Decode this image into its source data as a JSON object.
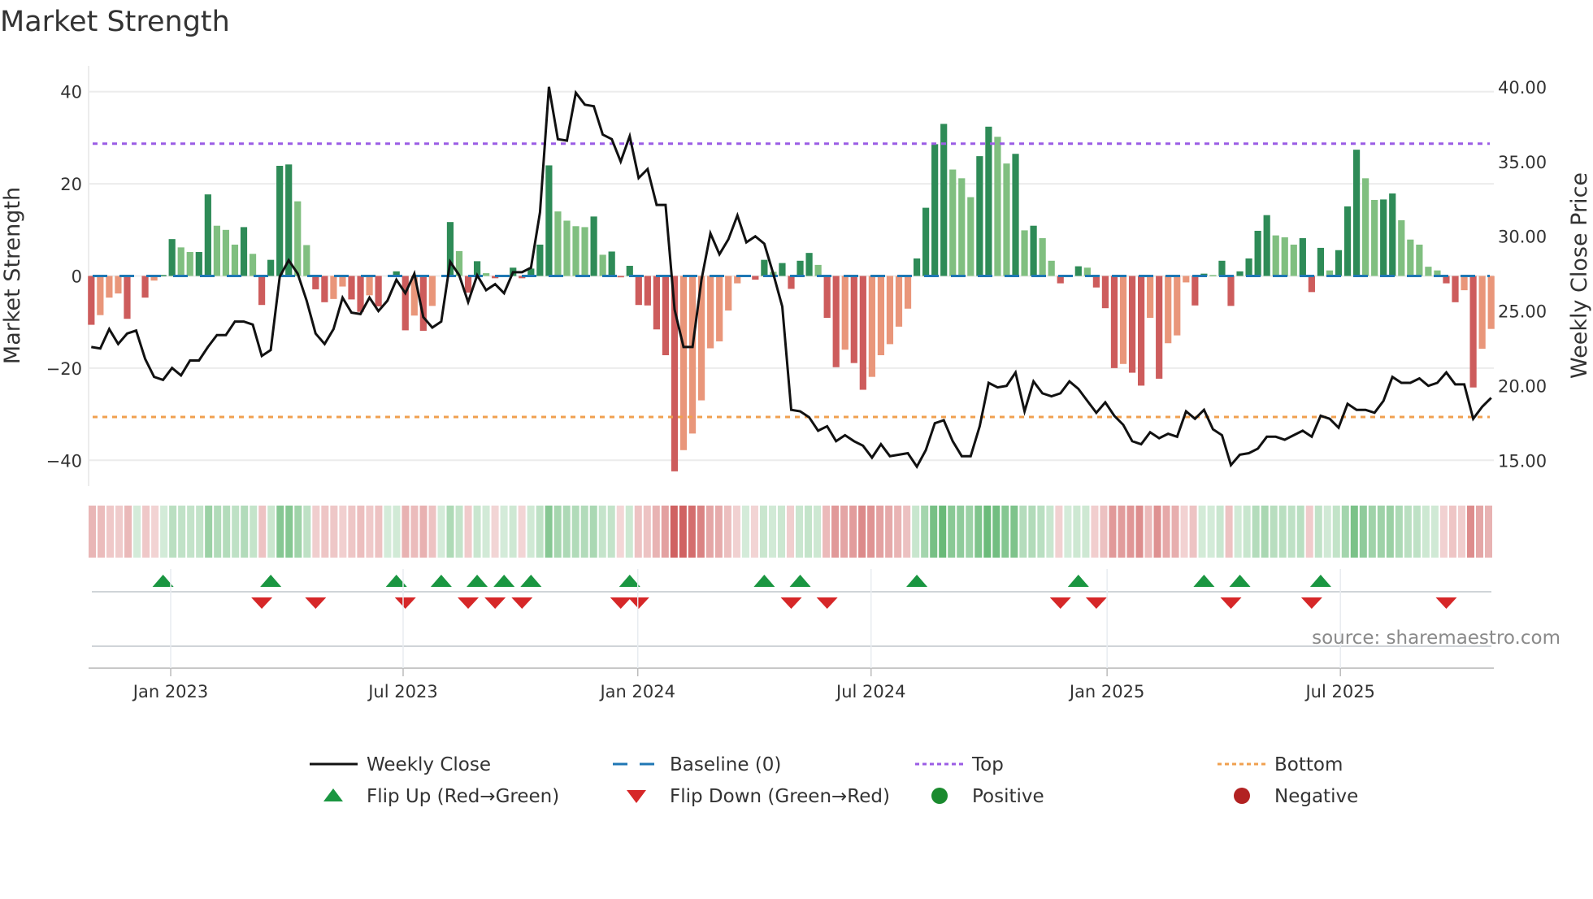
{
  "title": "Market Strength",
  "source": "source: sharemaestro.com",
  "chart_data": {
    "type": "bar",
    "title": "Market Strength",
    "frequency": "weekly",
    "ylabel": "Market Strength",
    "y2label": "Weekly Close Price",
    "ylim": [
      -45.6,
      45.6
    ],
    "y2lim": [
      13.3,
      41.4
    ],
    "yticks": [
      40,
      20,
      0,
      -20,
      -40
    ],
    "yticklabels": [
      "40",
      "20",
      "0",
      "−20",
      "−40"
    ],
    "y2ticks": [
      40,
      35,
      30,
      25,
      20,
      15
    ],
    "y2ticklabels": [
      "40.00",
      "35.00",
      "30.00",
      "25.00",
      "20.00",
      "15.00"
    ],
    "xticks": [
      {
        "label": "Jan 2023",
        "week": 8.85
      },
      {
        "label": "Jul 2023",
        "week": 34.75
      },
      {
        "label": "Jan 2024",
        "week": 60.9
      },
      {
        "label": "Jul 2024",
        "week": 86.9
      },
      {
        "label": "Jan 2025",
        "week": 113.2
      },
      {
        "label": "Jul 2025",
        "week": 139.2
      }
    ],
    "top_level": 28.7,
    "bottom_level": -30.6,
    "baseline": 0,
    "strength": [
      -10.6,
      -8.5,
      -4.7,
      -3.8,
      -9.3,
      0,
      -4.7,
      -1,
      0.2,
      8,
      6.2,
      5.2,
      5.2,
      17.7,
      10.9,
      10,
      6.8,
      10.6,
      4.8,
      -6.3,
      3.5,
      23.9,
      24.2,
      16.2,
      6.7,
      -2.9,
      -5.7,
      -5,
      -2.3,
      -5.1,
      -7.8,
      -4.2,
      -6.6,
      0,
      1,
      -11.8,
      -8.6,
      -11.9,
      -6.5,
      0,
      11.7,
      5.4,
      -3.6,
      3.2,
      0.6,
      -0.5,
      0,
      1.8,
      -0.5,
      1.6,
      6.8,
      24,
      14,
      12,
      10.8,
      10.6,
      12.9,
      4.6,
      5.3,
      -0.3,
      2.2,
      -6.3,
      -6.4,
      -11.6,
      -17.2,
      -42.4,
      -37.8,
      -34.2,
      -27,
      -15.7,
      -14.2,
      -7.5,
      -1.6,
      0,
      -0.8,
      3.5,
      0.9,
      2.8,
      -2.8,
      3.3,
      5,
      2.4,
      -9.1,
      -19.8,
      -16,
      -18.9,
      -24.7,
      -21.9,
      -17.2,
      -14.8,
      -11,
      -7.1,
      3.8,
      14.8,
      28.6,
      33,
      23.1,
      21.2,
      17.1,
      26,
      32.4,
      30.2,
      24.4,
      26.5,
      9.9,
      10.9,
      8.2,
      3.3,
      -1.6,
      0,
      2.1,
      1.8,
      -2.5,
      -7,
      -20,
      -19.1,
      -21,
      -23.8,
      -9.1,
      -22.3,
      -14.6,
      -12.9,
      -1.4,
      -6.4,
      0.5,
      0.2,
      3.3,
      -6.5,
      1,
      3.8,
      9.8,
      13.2,
      8.8,
      8.4,
      6.8,
      8.2,
      -3.5,
      6.1,
      1.2,
      5.6,
      15.1,
      27.4,
      21.2,
      16.5,
      16.6,
      17.9,
      12.1,
      7.9,
      6.8,
      2,
      1.2,
      -1.6,
      -5.7,
      -3.1,
      -24.2,
      -15.8,
      -11.5
    ],
    "weekly_close": [
      22.6,
      22.5,
      23.8,
      22.8,
      23.5,
      23.7,
      21.8,
      20.6,
      20.4,
      21.2,
      20.7,
      21.7,
      21.7,
      22.6,
      23.4,
      23.4,
      24.3,
      24.3,
      24.1,
      22.0,
      22.4,
      27.3,
      28.4,
      27.5,
      25.7,
      23.5,
      22.8,
      23.8,
      25.9,
      24.9,
      24.8,
      25.9,
      25.0,
      25.7,
      27.1,
      26.2,
      27.5,
      24.6,
      23.9,
      24.3,
      28.3,
      27.4,
      25.6,
      27.4,
      26.4,
      26.8,
      26.2,
      27.6,
      27.6,
      27.9,
      31.6,
      40.0,
      36.5,
      36.4,
      39.6,
      38.8,
      38.7,
      36.8,
      36.5,
      35.0,
      36.7,
      33.9,
      34.5,
      32.1,
      32.1,
      25.1,
      22.6,
      22.6,
      27.1,
      30.2,
      28.8,
      29.8,
      31.4,
      29.6,
      30.0,
      29.5,
      27.5,
      25.3,
      18.4,
      18.3,
      17.9,
      17.0,
      17.3,
      16.3,
      16.7,
      16.3,
      16.0,
      15.2,
      16.1,
      15.3,
      15.4,
      15.5,
      14.6,
      15.7,
      17.5,
      17.7,
      16.3,
      15.3,
      15.3,
      17.3,
      20.2,
      19.9,
      20.0,
      20.9,
      18.3,
      20.3,
      19.5,
      19.3,
      19.5,
      20.3,
      19.8,
      19.0,
      18.2,
      18.9,
      18.0,
      17.4,
      16.3,
      16.1,
      16.9,
      16.5,
      16.8,
      16.6,
      18.3,
      17.8,
      18.4,
      17.1,
      16.7,
      14.7,
      15.4,
      15.5,
      15.8,
      16.6,
      16.6,
      16.4,
      16.7,
      17.0,
      16.6,
      18.0,
      17.8,
      17.2,
      18.8,
      18.4,
      18.4,
      18.2,
      19.0,
      20.6,
      20.2,
      20.2,
      20.5,
      20.0,
      20.2,
      20.9,
      20.1,
      20.1,
      17.8,
      18.6,
      19.2
    ],
    "flip_up_weeks": [
      8,
      20,
      34,
      39,
      43,
      46,
      49,
      60,
      75,
      79,
      92,
      110,
      124,
      128,
      137
    ],
    "flip_down_weeks": [
      19,
      25,
      35,
      42,
      45,
      48,
      59,
      61,
      78,
      82,
      108,
      112,
      127,
      136,
      151
    ],
    "colors": {
      "pos_strong": "#2e8b57",
      "pos_weak": "#80bf80",
      "neg_strong": "#cd5c5c",
      "neg_weak": "#e9967a",
      "price": "#111111",
      "baseline": "#1f77b4",
      "top": "#9b5de5",
      "bottom": "#f0a050",
      "flip_up": "#1a9641",
      "flip_down": "#d62728",
      "positive": "#1a8a2e",
      "negative": "#b22222"
    },
    "legend": {
      "placement": "bottom",
      "items": [
        {
          "label": "Weekly Close",
          "kind": "line"
        },
        {
          "label": "Baseline (0)",
          "kind": "dash"
        },
        {
          "label": "Top",
          "kind": "dot-top"
        },
        {
          "label": "Bottom",
          "kind": "dot-bottom"
        },
        {
          "label": "Flip Up (Red→Green)",
          "kind": "tri-up"
        },
        {
          "label": "Flip Down (Green→Red)",
          "kind": "tri-down"
        },
        {
          "label": "Positive",
          "kind": "circle-pos"
        },
        {
          "label": "Negative",
          "kind": "circle-neg"
        }
      ]
    }
  }
}
